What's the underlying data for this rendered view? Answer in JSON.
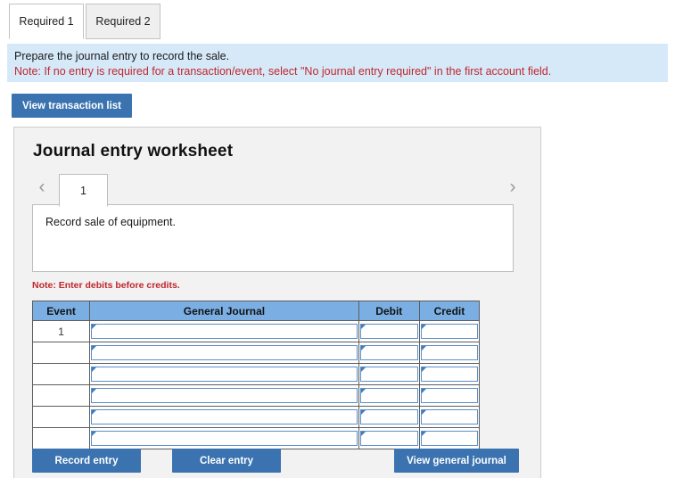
{
  "tabs": [
    {
      "label": "Required 1",
      "active": true
    },
    {
      "label": "Required 2",
      "active": false
    }
  ],
  "instructions": {
    "line1": "Prepare the journal entry to record the sale.",
    "line2": "Note: If no entry is required for a transaction/event, select \"No journal entry required\" in the first account field."
  },
  "toolbar": {
    "view_transaction_list_label": "View transaction list"
  },
  "worksheet": {
    "title": "Journal entry worksheet",
    "pager": {
      "prev_glyph": "‹",
      "next_glyph": "›",
      "current_page": "1"
    },
    "description": "Record sale of equipment.",
    "note": "Note: Enter debits before credits.",
    "table": {
      "headers": [
        "Event",
        "General Journal",
        "Debit",
        "Credit"
      ],
      "rows": [
        {
          "event": "1",
          "general_journal": "",
          "debit": "",
          "credit": ""
        },
        {
          "event": "",
          "general_journal": "",
          "debit": "",
          "credit": ""
        },
        {
          "event": "",
          "general_journal": "",
          "debit": "",
          "credit": ""
        },
        {
          "event": "",
          "general_journal": "",
          "debit": "",
          "credit": ""
        },
        {
          "event": "",
          "general_journal": "",
          "debit": "",
          "credit": ""
        },
        {
          "event": "",
          "general_journal": "",
          "debit": "",
          "credit": ""
        }
      ]
    },
    "actions": {
      "record_entry_label": "Record entry",
      "clear_entry_label": "Clear entry",
      "view_general_journal_label": "View general journal"
    }
  },
  "colors": {
    "button_blue": "#3b73b0",
    "table_header_blue": "#7bafe3",
    "instruction_bg": "#d6e9f8",
    "warn_red": "#c0272d",
    "panel_gray": "#f2f2f2"
  }
}
